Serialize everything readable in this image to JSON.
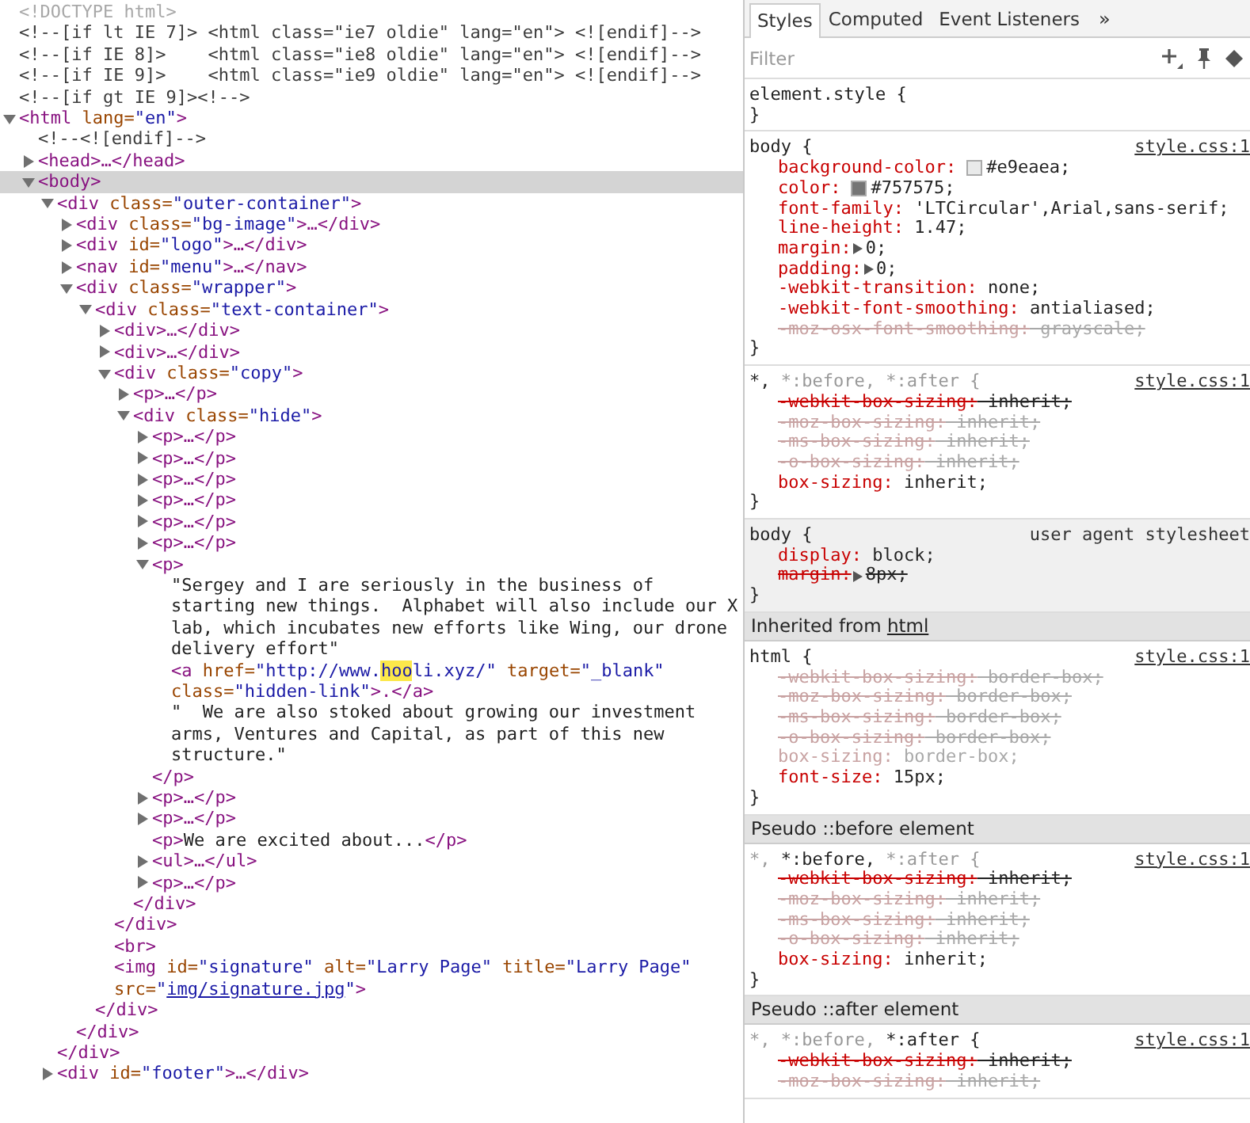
{
  "dom": [
    {
      "kind": "doctype",
      "text": "<!DOCTYPE html>",
      "selected": false
    },
    {
      "kind": "comment",
      "text": "<!--[if lt IE 7]> <html class=\"ie7 oldie\" lang=\"en\"> <![endif]-->",
      "selected": false
    },
    {
      "kind": "comment",
      "text": "<!--[if IE 8]>    <html class=\"ie8 oldie\" lang=\"en\"> <![endif]-->",
      "selected": false
    },
    {
      "kind": "comment",
      "text": "<!--[if IE 9]>    <html class=\"ie9 oldie\" lang=\"en\"> <![endif]-->",
      "selected": false
    },
    {
      "kind": "comment",
      "text": "<!--[if gt IE 9]><!-->",
      "selected": false
    },
    {
      "kind": "element",
      "open": "<html",
      "attrs": [
        {
          "name": " lang=",
          "value": "\"en\""
        }
      ],
      "end": ">",
      "expanded": true,
      "selected": false,
      "children": [
        {
          "kind": "comment",
          "text": "<!--<![endif]-->",
          "selected": false
        },
        {
          "kind": "element",
          "open": "<head",
          "end": ">…</head>",
          "expanded": false,
          "selected": false
        },
        {
          "kind": "element",
          "open": "<body",
          "end": ">",
          "expanded": true,
          "selected": true,
          "children": [
            {
              "kind": "element",
              "open": "<div",
              "attrs": [
                {
                  "name": " class=",
                  "value": "\"outer-container\""
                }
              ],
              "end": ">",
              "expanded": true,
              "selected": false,
              "close": "</div>",
              "children": [
                {
                  "kind": "element",
                  "open": "<div",
                  "attrs": [
                    {
                      "name": " class=",
                      "value": "\"bg-image\""
                    }
                  ],
                  "end": ">…</div>",
                  "expanded": false,
                  "selected": false
                },
                {
                  "kind": "element",
                  "open": "<div",
                  "attrs": [
                    {
                      "name": " id=",
                      "value": "\"logo\""
                    }
                  ],
                  "end": ">…</div>",
                  "expanded": false,
                  "selected": false
                },
                {
                  "kind": "element",
                  "open": "<nav",
                  "attrs": [
                    {
                      "name": " id=",
                      "value": "\"menu\""
                    }
                  ],
                  "end": ">…</nav>",
                  "expanded": false,
                  "selected": false
                },
                {
                  "kind": "element",
                  "open": "<div",
                  "attrs": [
                    {
                      "name": " class=",
                      "value": "\"wrapper\""
                    }
                  ],
                  "end": ">",
                  "expanded": true,
                  "selected": false,
                  "close": "</div>",
                  "children": [
                    {
                      "kind": "element",
                      "open": "<div",
                      "attrs": [
                        {
                          "name": " class=",
                          "value": "\"text-container\""
                        }
                      ],
                      "end": ">",
                      "expanded": true,
                      "selected": false,
                      "close": "</div>",
                      "children": [
                        {
                          "kind": "element",
                          "open": "<div",
                          "end": ">…</div>",
                          "expanded": false,
                          "selected": false
                        },
                        {
                          "kind": "element",
                          "open": "<div",
                          "end": ">…</div>",
                          "expanded": false,
                          "selected": false
                        },
                        {
                          "kind": "element",
                          "open": "<div",
                          "attrs": [
                            {
                              "name": " class=",
                              "value": "\"copy\""
                            }
                          ],
                          "end": ">",
                          "expanded": true,
                          "selected": false,
                          "close": "</div>",
                          "children": [
                            {
                              "kind": "element",
                              "open": "<p",
                              "end": ">…</p>",
                              "expanded": false,
                              "selected": false
                            },
                            {
                              "kind": "element",
                              "open": "<div",
                              "attrs": [
                                {
                                  "name": " class=",
                                  "value": "\"hide\""
                                }
                              ],
                              "end": ">",
                              "expanded": true,
                              "selected": false,
                              "close": "</div>",
                              "children": [
                                {
                                  "kind": "element",
                                  "open": "<p",
                                  "end": ">…</p>",
                                  "expanded": false,
                                  "selected": false
                                },
                                {
                                  "kind": "element",
                                  "open": "<p",
                                  "end": ">…</p>",
                                  "expanded": false,
                                  "selected": false
                                },
                                {
                                  "kind": "element",
                                  "open": "<p",
                                  "end": ">…</p>",
                                  "expanded": false,
                                  "selected": false
                                },
                                {
                                  "kind": "element",
                                  "open": "<p",
                                  "end": ">…</p>",
                                  "expanded": false,
                                  "selected": false
                                },
                                {
                                  "kind": "element",
                                  "open": "<p",
                                  "end": ">…</p>",
                                  "expanded": false,
                                  "selected": false
                                },
                                {
                                  "kind": "element",
                                  "open": "<p",
                                  "end": ">…</p>",
                                  "expanded": false,
                                  "selected": false
                                },
                                {
                                  "kind": "element",
                                  "open": "<p",
                                  "end": ">",
                                  "expanded": true,
                                  "selected": false,
                                  "close": "</p>",
                                  "children": [
                                    {
                                      "kind": "text",
                                      "text": "\"Sergey and I are seriously in the business of starting new things.  Alphabet will also include our X lab, which incubates new efforts like Wing, our drone delivery effort\"",
                                      "selected": false
                                    },
                                    {
                                      "kind": "element",
                                      "open": "<a",
                                      "attrs": [
                                        {
                                          "name": " href=",
                                          "value": [
                                            {
                                              "text": "\"http://www.",
                                              "kind": "plain"
                                            },
                                            {
                                              "text": "hoo",
                                              "kind": "match"
                                            },
                                            {
                                              "text": "li.xyz/\"",
                                              "kind": "plain"
                                            }
                                          ]
                                        },
                                        {
                                          "name": " target=",
                                          "value": "\"_blank\""
                                        },
                                        {
                                          "name": " class=",
                                          "value": "\"hidden-link\""
                                        }
                                      ],
                                      "end": ">.</a>",
                                      "selected": false
                                    },
                                    {
                                      "kind": "text",
                                      "text": "\"  We are also stoked about growing our investment arms, Ventures and Capital, as part of this new structure.\"",
                                      "selected": false
                                    }
                                  ]
                                },
                                {
                                  "kind": "element",
                                  "open": "<p",
                                  "end": ">…</p>",
                                  "expanded": false,
                                  "selected": false
                                },
                                {
                                  "kind": "element",
                                  "open": "<p",
                                  "end": ">…</p>",
                                  "expanded": false,
                                  "selected": false
                                },
                                {
                                  "kind": "element",
                                  "open": "<p",
                                  "end": ">",
                                  "inner": "We are excited about...",
                                  "tail": "</p>",
                                  "selected": false
                                },
                                {
                                  "kind": "element",
                                  "open": "<ul",
                                  "end": ">…</ul>",
                                  "expanded": false,
                                  "selected": false
                                },
                                {
                                  "kind": "element",
                                  "open": "<p",
                                  "end": ">…</p>",
                                  "expanded": false,
                                  "selected": false
                                }
                              ]
                            }
                          ]
                        },
                        {
                          "kind": "element",
                          "open": "<br",
                          "end": ">",
                          "selected": false
                        },
                        {
                          "kind": "element",
                          "open": "<img",
                          "attrs": [
                            {
                              "name": " id=",
                              "value": "\"signature\""
                            },
                            {
                              "name": " alt=",
                              "value": "\"Larry Page\""
                            },
                            {
                              "name": " title=",
                              "value": "\"Larry Page\""
                            },
                            {
                              "name": " src=",
                              "value": [
                                {
                                  "text": "\"",
                                  "kind": "plain"
                                },
                                {
                                  "text": "img/signature.jpg",
                                  "kind": "link"
                                },
                                {
                                  "text": "\"",
                                  "kind": "plain"
                                }
                              ]
                            }
                          ],
                          "end": ">",
                          "selected": false
                        }
                      ]
                    }
                  ]
                }
              ]
            },
            {
              "kind": "element",
              "open": "<div",
              "attrs": [
                {
                  "name": " id=",
                  "value": "\"footer\""
                }
              ],
              "end": ">…</div>",
              "expanded": false,
              "selected": false
            }
          ]
        }
      ]
    }
  ],
  "tabs": [
    {
      "label": "Styles",
      "selected": true
    },
    {
      "label": "Computed",
      "selected": false
    },
    {
      "label": "Event Listeners",
      "selected": false
    }
  ],
  "more_tabs": "»",
  "filter": {
    "placeholder": "Filter"
  },
  "sections": [
    {
      "kind": "rule",
      "selector": [
        {
          "text": "element.style {",
          "matched": true
        }
      ],
      "close": "}",
      "user_agent": false
    },
    {
      "kind": "rule",
      "selector": [
        {
          "text": "body {",
          "matched": true
        }
      ],
      "source": "style.css:1",
      "user_agent": false,
      "close": "}",
      "properties": [
        {
          "name": "background-color:",
          "kind": "color",
          "value": "#e9eaea",
          "suffix": ";",
          "expandable": false,
          "struck": false,
          "dimmed": false
        },
        {
          "name": "color:",
          "kind": "color",
          "value": "#757575",
          "suffix": ";",
          "expandable": false,
          "struck": false,
          "dimmed": false
        },
        {
          "name": "font-family:",
          "value": " 'LTCircular',Arial,sans-serif;",
          "expandable": false,
          "struck": false,
          "dimmed": false
        },
        {
          "name": "line-height:",
          "value": " 1.47;",
          "expandable": false,
          "struck": false,
          "dimmed": false
        },
        {
          "name": "margin:",
          "value": "0;",
          "expandable": true,
          "struck": false,
          "dimmed": false
        },
        {
          "name": "padding:",
          "value": "0;",
          "expandable": true,
          "struck": false,
          "dimmed": false
        },
        {
          "name": "-webkit-transition:",
          "value": " none;",
          "expandable": false,
          "struck": false,
          "dimmed": false
        },
        {
          "name": "-webkit-font-smoothing:",
          "value": " antialiased;",
          "expandable": false,
          "struck": false,
          "dimmed": false
        },
        {
          "name": "-moz-osx-font-smoothing:",
          "value": " grayscale;",
          "expandable": false,
          "struck": true,
          "dimmed": true
        }
      ]
    },
    {
      "kind": "rule",
      "selector": [
        {
          "text": "*,",
          "matched": true
        },
        {
          "text": " *:before, *:after {",
          "matched": false
        }
      ],
      "source": "style.css:1",
      "user_agent": false,
      "close": "}",
      "properties": [
        {
          "name": "-webkit-box-sizing:",
          "value": " inherit;",
          "expandable": false,
          "struck": true,
          "dimmed": false
        },
        {
          "name": "-moz-box-sizing:",
          "value": " inherit;",
          "expandable": false,
          "struck": true,
          "dimmed": true
        },
        {
          "name": "-ms-box-sizing:",
          "value": " inherit;",
          "expandable": false,
          "struck": true,
          "dimmed": true
        },
        {
          "name": "-o-box-sizing:",
          "value": " inherit;",
          "expandable": false,
          "struck": true,
          "dimmed": true
        },
        {
          "name": "box-sizing:",
          "value": " inherit;",
          "expandable": false,
          "struck": false,
          "dimmed": false
        }
      ]
    },
    {
      "kind": "rule",
      "selector": [
        {
          "text": "body {",
          "matched": true
        }
      ],
      "source": "user agent stylesheet",
      "user_agent": true,
      "close": "}",
      "properties": [
        {
          "name": "display:",
          "value": " block;",
          "expandable": false,
          "struck": false,
          "dimmed": false
        },
        {
          "name": "margin:",
          "value": "8px;",
          "expandable": true,
          "struck": true,
          "dimmed": false
        }
      ]
    },
    {
      "kind": "header",
      "text": "Inherited from ",
      "link": "html"
    },
    {
      "kind": "rule",
      "selector": [
        {
          "text": "html {",
          "matched": true
        }
      ],
      "source": "style.css:1",
      "user_agent": false,
      "close": "}",
      "properties": [
        {
          "name": "-webkit-box-sizing:",
          "value": " border-box;",
          "expandable": false,
          "struck": true,
          "dimmed": true
        },
        {
          "name": "-moz-box-sizing:",
          "value": " border-box;",
          "expandable": false,
          "struck": true,
          "dimmed": true
        },
        {
          "name": "-ms-box-sizing:",
          "value": " border-box;",
          "expandable": false,
          "struck": true,
          "dimmed": true
        },
        {
          "name": "-o-box-sizing:",
          "value": " border-box;",
          "expandable": false,
          "struck": true,
          "dimmed": true
        },
        {
          "name": "box-sizing:",
          "value": " border-box;",
          "expandable": false,
          "struck": false,
          "dimmed": true
        },
        {
          "name": "font-size:",
          "value": " 15px;",
          "expandable": false,
          "struck": false,
          "dimmed": false
        }
      ]
    },
    {
      "kind": "header",
      "text": "Pseudo ::before element"
    },
    {
      "kind": "rule",
      "selector": [
        {
          "text": "*,",
          "matched": false
        },
        {
          "text": " *:before,",
          "matched": true
        },
        {
          "text": " *:after {",
          "matched": false
        }
      ],
      "source": "style.css:1",
      "user_agent": false,
      "close": "}",
      "properties": [
        {
          "name": "-webkit-box-sizing:",
          "value": " inherit;",
          "expandable": false,
          "struck": true,
          "dimmed": false
        },
        {
          "name": "-moz-box-sizing:",
          "value": " inherit;",
          "expandable": false,
          "struck": true,
          "dimmed": true
        },
        {
          "name": "-ms-box-sizing:",
          "value": " inherit;",
          "expandable": false,
          "struck": true,
          "dimmed": true
        },
        {
          "name": "-o-box-sizing:",
          "value": " inherit;",
          "expandable": false,
          "struck": true,
          "dimmed": true
        },
        {
          "name": "box-sizing:",
          "value": " inherit;",
          "expandable": false,
          "struck": false,
          "dimmed": false
        }
      ]
    },
    {
      "kind": "header",
      "text": "Pseudo ::after element"
    },
    {
      "kind": "rule",
      "selector": [
        {
          "text": "*, *:before,",
          "matched": false
        },
        {
          "text": " *:after {",
          "matched": true
        }
      ],
      "source": "style.css:1",
      "user_agent": false,
      "properties": [
        {
          "name": "-webkit-box-sizing:",
          "value": " inherit;",
          "expandable": false,
          "struck": true,
          "dimmed": false
        },
        {
          "name": "-moz-box-sizing:",
          "value": " inherit;",
          "expandable": false,
          "struck": true,
          "dimmed": true
        }
      ]
    }
  ]
}
